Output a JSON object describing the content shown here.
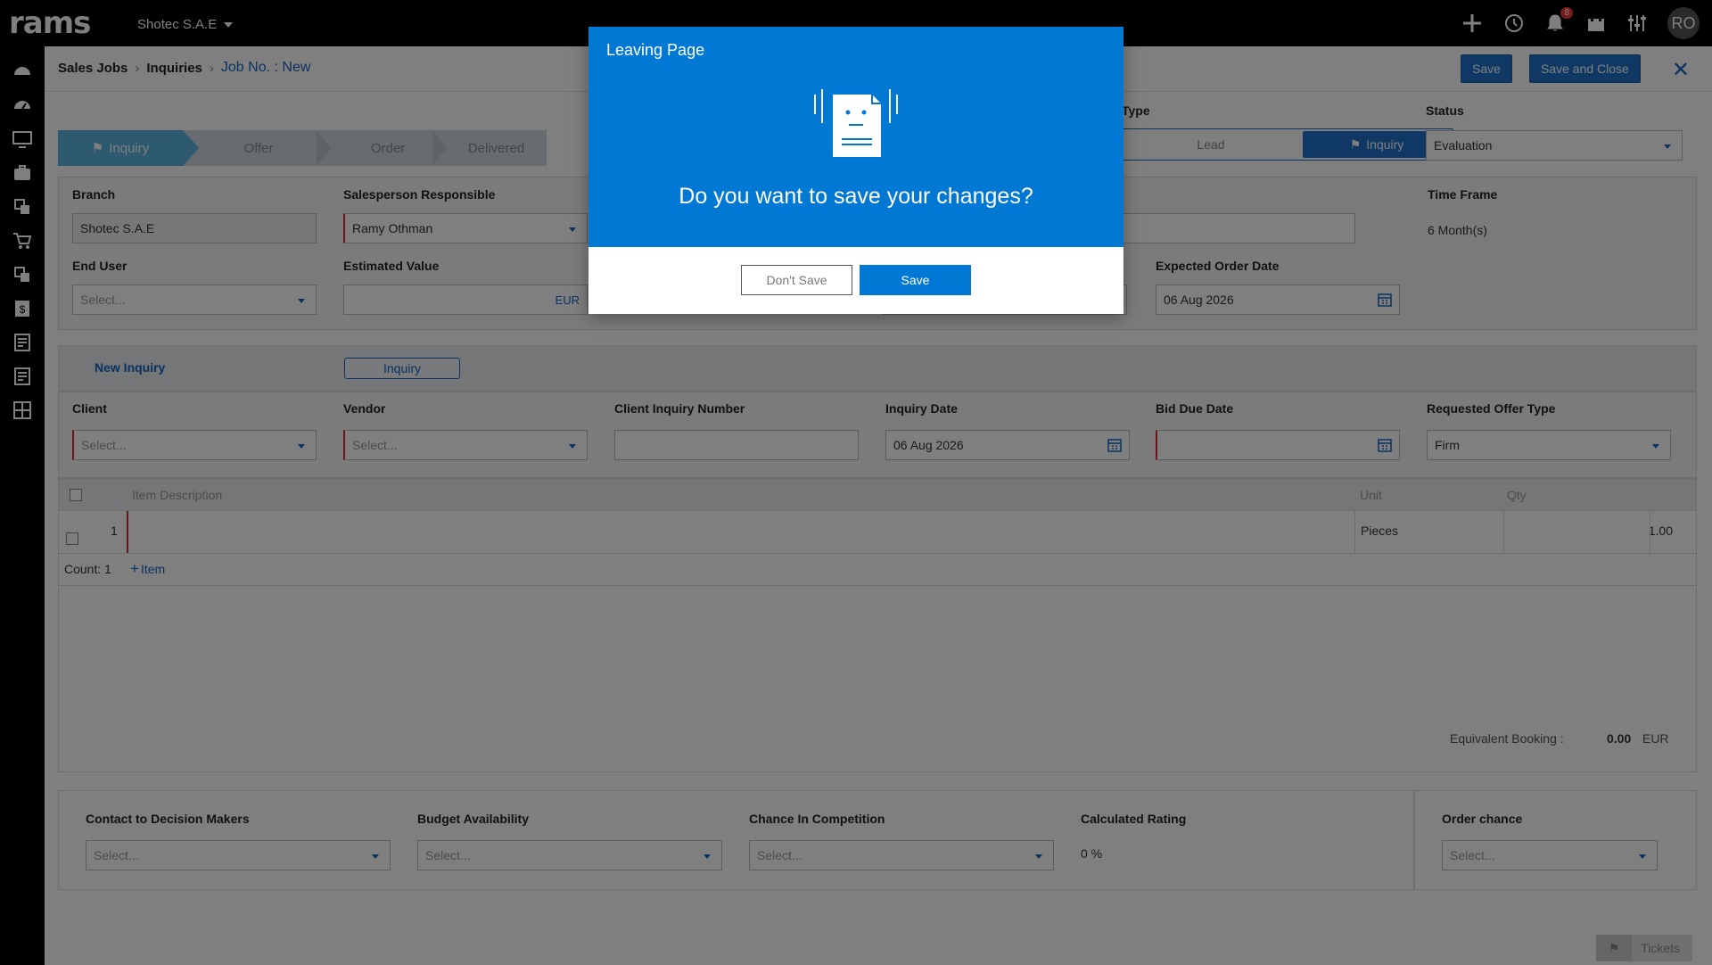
{
  "app": {
    "logo": "rams",
    "company": "Shotec S.A.E",
    "avatar_initials": "RO",
    "notification_count": "8"
  },
  "breadcrumb": {
    "item1": "Sales Jobs",
    "item2": "Inquiries",
    "current": "Job No. : New"
  },
  "toolbar": {
    "save_label": "Save",
    "save_close_label": "Save and Close"
  },
  "stepper": [
    "Inquiry",
    "Offer",
    "Order",
    "Delivered"
  ],
  "type": {
    "label": "Type",
    "lead": "Lead",
    "inquiry": "Inquiry"
  },
  "status": {
    "label": "Status",
    "value": "Evaluation"
  },
  "form": {
    "branch": {
      "label": "Branch",
      "value": "Shotec S.A.E"
    },
    "salesperson": {
      "label": "Salesperson Responsible",
      "value": "Ramy  Othman"
    },
    "time_frame": {
      "label": "Time Frame",
      "value": "6 Month(s)"
    },
    "end_user": {
      "label": "End User",
      "placeholder": "Select..."
    },
    "estimated_value": {
      "label": "Estimated Value",
      "currency": "EUR"
    },
    "expected_order_date": {
      "label": "Expected Order Date",
      "value": "06 Aug 2026"
    }
  },
  "sub_tabs": {
    "new_inquiry": "New Inquiry",
    "inquiry": "Inquiry"
  },
  "inquiry_form": {
    "client": {
      "label": "Client",
      "placeholder": "Select..."
    },
    "vendor": {
      "label": "Vendor",
      "placeholder": "Select..."
    },
    "client_inquiry_number": {
      "label": "Client Inquiry Number"
    },
    "inquiry_date": {
      "label": "Inquiry Date",
      "value": "06 Aug 2026"
    },
    "bid_due_date": {
      "label": "Bid Due Date"
    },
    "requested_offer_type": {
      "label": "Requested Offer Type",
      "value": "Firm"
    }
  },
  "items_table": {
    "headers": {
      "description": "Item Description",
      "unit": "Unit",
      "qty": "Qty"
    },
    "rows": [
      {
        "no": "1",
        "unit": "Pieces",
        "qty": "1.00"
      }
    ],
    "count_label": "Count: 1",
    "add_item": "Item",
    "equivalent_label": "Equivalent Booking :",
    "equivalent_value": "0.00",
    "equivalent_currency": "EUR"
  },
  "rating": {
    "contact": {
      "label": "Contact to Decision Makers",
      "placeholder": "Select..."
    },
    "budget": {
      "label": "Budget Availability",
      "placeholder": "Select..."
    },
    "competition": {
      "label": "Chance In Competition",
      "placeholder": "Select..."
    },
    "calculated": {
      "label": "Calculated Rating",
      "value": "0 %"
    },
    "order_chance": {
      "label": "Order chance",
      "placeholder": "Select..."
    }
  },
  "tickets": {
    "label": "Tickets"
  },
  "modal": {
    "title": "Leaving Page",
    "question": "Do you want to save your changes?",
    "dont_save": "Don't Save",
    "save": "Save"
  }
}
